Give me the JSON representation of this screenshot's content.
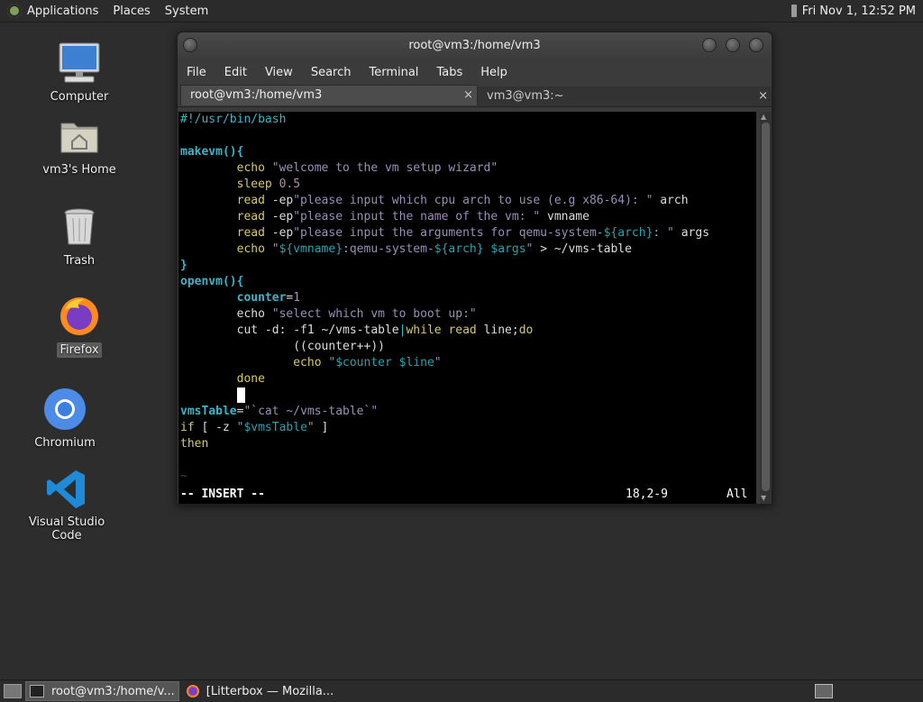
{
  "top_panel": {
    "menus": [
      "Applications",
      "Places",
      "System"
    ],
    "clock": "Fri Nov 1, 12:52 PM"
  },
  "desktop": {
    "icons": [
      {
        "label": "Computer"
      },
      {
        "label": "vm3's Home"
      },
      {
        "label": "Trash"
      },
      {
        "label": "Firefox"
      },
      {
        "label": "Chromium"
      },
      {
        "label": "Visual Studio Code"
      }
    ]
  },
  "window": {
    "title": "root@vm3:/home/vm3",
    "menu": [
      "File",
      "Edit",
      "View",
      "Search",
      "Terminal",
      "Tabs",
      "Help"
    ],
    "tabs": [
      {
        "label": "root@vm3:/home/vm3"
      },
      {
        "label": "vm3@vm3:~"
      }
    ],
    "close_glyph": "×"
  },
  "editor": {
    "lines": {
      "l1": "#!/usr/bin/bash",
      "l3a": "makevm(){",
      "l4a": "        echo ",
      "l4b": "\"welcome to the vm setup wizard\"",
      "l5a": "        sleep ",
      "l5b": "0.5",
      "l6a": "        read ",
      "l6b": "-ep",
      "l6c": "\"please input which cpu arch to use (e.g x86-64): \"",
      "l6d": " arch",
      "l7a": "        read ",
      "l7b": "-ep",
      "l7c": "\"please input the name of the vm: \"",
      "l7d": " vmname",
      "l8a": "        read ",
      "l8b": "-ep",
      "l8c": "\"please input the arguments for qemu-system-",
      "l8v": "${arch}",
      "l8e": ": \"",
      "l8d": " args",
      "l9a": "        echo ",
      "l9b": "\"",
      "l9v1": "${vmname}",
      "l9c": ":qemu-system-",
      "l9v2": "${arch}",
      "l9d": " ",
      "l9v3": "$args",
      "l9e": "\"",
      "l9f": " > ~/vms-table",
      "l10": "}",
      "l11": "openvm(){",
      "l12a": "        counter",
      "l12b": "=",
      "l12c": "1",
      "l13a": "        echo ",
      "l13b": "\"select which vm to boot up:\"",
      "l14a": "        cut -d: -f1 ~/vms-table",
      "l14b": "|",
      "l14c": "while ",
      "l14d": "read ",
      "l14e": "line;",
      "l14f": "do",
      "l15": "                ((counter++))",
      "l16a": "                echo ",
      "l16b": "\"",
      "l16v1": "$counter",
      "l16c": "\"",
      "l16d": " ",
      "l16v2": "$line",
      "l16e": "\"",
      "l17": "        done",
      "l18": "        ",
      "l19a": "vmsTable",
      "l19b": "=",
      "l19c": "\"`cat ~/vms-table`\"",
      "l20a": "if ",
      "l20b": "[ -z ",
      "l20c": "\"",
      "l20v": "$vmsTable",
      "l20d": "\"",
      "l20e": " ]",
      "l21": "then",
      "tilde": "~"
    },
    "status_mode": "-- INSERT --",
    "status_pos": "18,2-9",
    "status_scroll": "All"
  },
  "taskbar": {
    "items": [
      {
        "label": "root@vm3:/home/v..."
      },
      {
        "label": "[Litterbox — Mozilla..."
      }
    ]
  }
}
